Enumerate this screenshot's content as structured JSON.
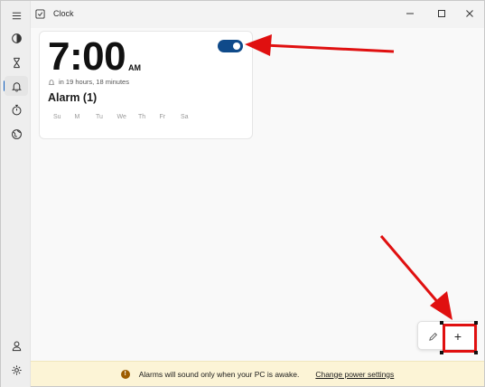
{
  "app": {
    "title": "Clock"
  },
  "nav": {
    "items": [
      {
        "name": "focus-sessions",
        "icon": "focus-icon"
      },
      {
        "name": "timer",
        "icon": "hourglass-icon"
      },
      {
        "name": "alarm",
        "icon": "bell-icon",
        "active": true
      },
      {
        "name": "stopwatch",
        "icon": "stopwatch-icon"
      },
      {
        "name": "world-clock",
        "icon": "globe-icon"
      }
    ],
    "bottom": [
      {
        "name": "account",
        "icon": "person-icon"
      },
      {
        "name": "settings",
        "icon": "gear-icon"
      }
    ]
  },
  "alarm": {
    "time": "7:00",
    "ampm": "AM",
    "enabled": true,
    "remaining": "in 19 hours, 18 minutes",
    "name": "Alarm (1)",
    "days": [
      "Su",
      "M",
      "Tu",
      "We",
      "Th",
      "Fr",
      "Sa"
    ]
  },
  "toolbar": {
    "edit_icon": "pencil-icon",
    "add_label": "+"
  },
  "info": {
    "message": "Alarms will sound only when your PC is awake.",
    "link": "Change power settings"
  },
  "colors": {
    "accent": "#0f4a8a",
    "annotation": "#e01010",
    "info_bg": "#fcf4d6",
    "info_icon": "#9d5d00"
  }
}
